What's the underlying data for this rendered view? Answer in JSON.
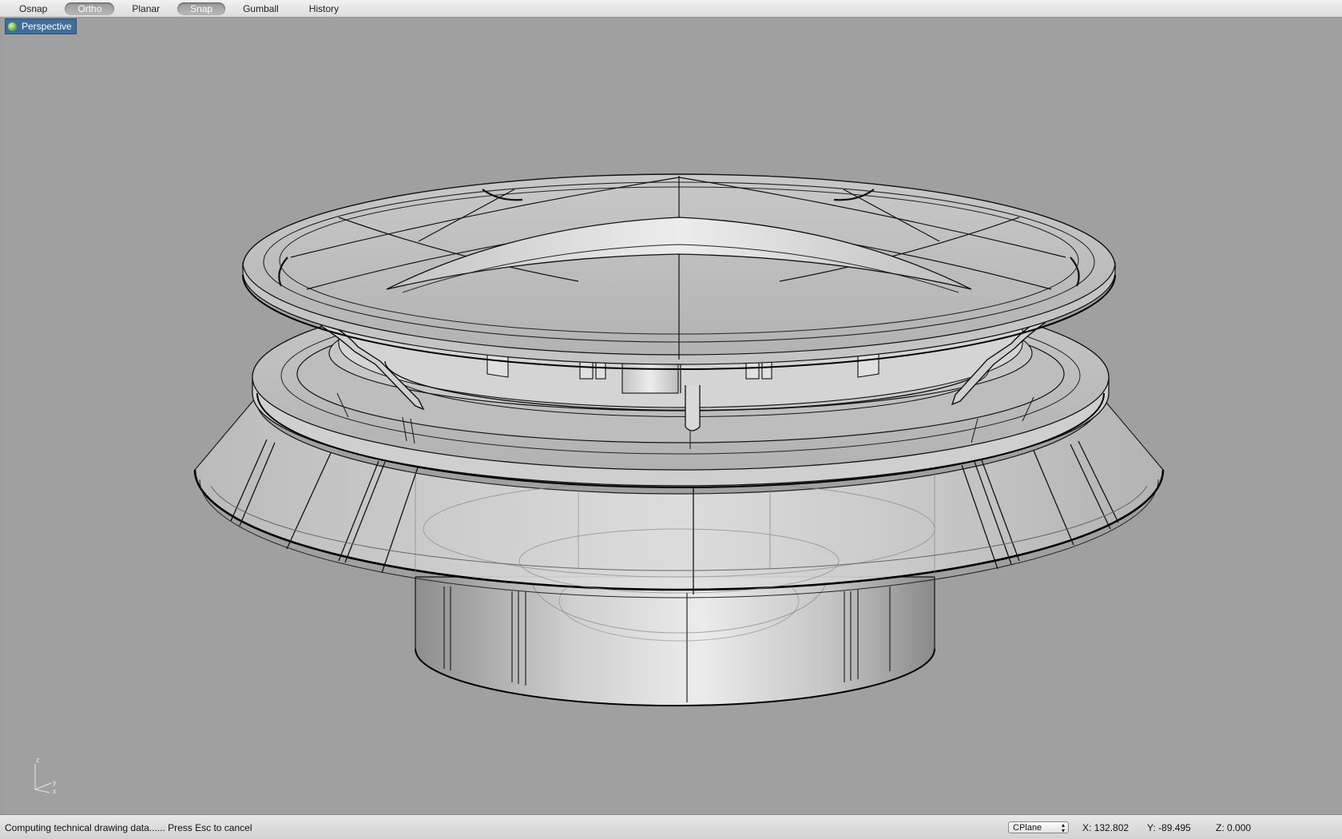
{
  "toolbar": {
    "toggles": [
      {
        "label": "Osnap",
        "active": false
      },
      {
        "label": "Ortho",
        "active": true
      },
      {
        "label": "Planar",
        "active": false
      },
      {
        "label": "Snap",
        "active": true
      },
      {
        "label": "Gumball",
        "active": false
      },
      {
        "label": "History",
        "active": false
      }
    ]
  },
  "viewport": {
    "title": "Perspective",
    "axis_labels": {
      "z": "z",
      "y": "y",
      "x": "x"
    }
  },
  "status": {
    "message": "Computing technical drawing data...... Press Esc to cancel",
    "cplane": "CPlane",
    "x_label": "X:",
    "x_value": "132.802",
    "y_label": "Y:",
    "y_value": "-89.495",
    "z_label": "Z:",
    "z_value": "0.000"
  },
  "colors": {
    "viewport_bg": "#a0a0a0",
    "tab_bg": "#3f6c9a",
    "active_toggle": "#a8a8a8"
  }
}
